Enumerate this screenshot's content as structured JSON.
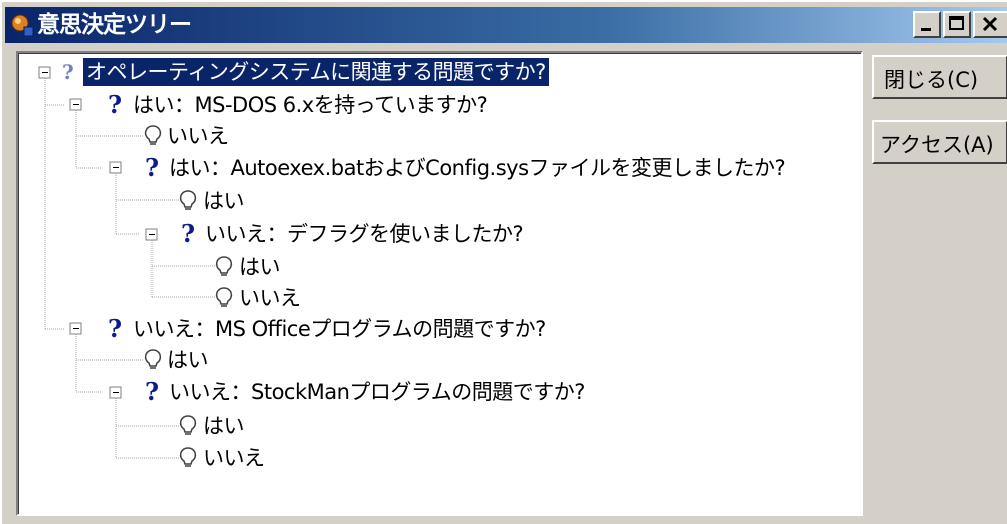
{
  "window": {
    "title": "意思決定ツリー",
    "controls": {
      "minimize": "minimize",
      "maximize": "maximize",
      "close": "close"
    }
  },
  "tree": {
    "root": "オペレーティングシステムに関連する問題ですか?",
    "n1": "はい：MS-DOS 6.xを持っていますか?",
    "n1a": "いいえ",
    "n1b": "はい：Autoexex.batおよびConfig.sysファイルを変更しましたか?",
    "n1b1": "はい",
    "n1b2": "いいえ：デフラグを使いましたか?",
    "n1b2a": "はい",
    "n1b2b": "いいえ",
    "n2": "いいえ：MS Officeプログラムの問題ですか?",
    "n2a": "はい",
    "n2b": "いいえ：StockManプログラムの問題ですか?",
    "n2b1": "はい",
    "n2b2": "いいえ"
  },
  "buttons": {
    "close": "閉じる(C)",
    "access": "アクセス(A)"
  },
  "icons": {
    "question": "?",
    "app": "app-icon",
    "answer": "lightbulb-icon"
  }
}
